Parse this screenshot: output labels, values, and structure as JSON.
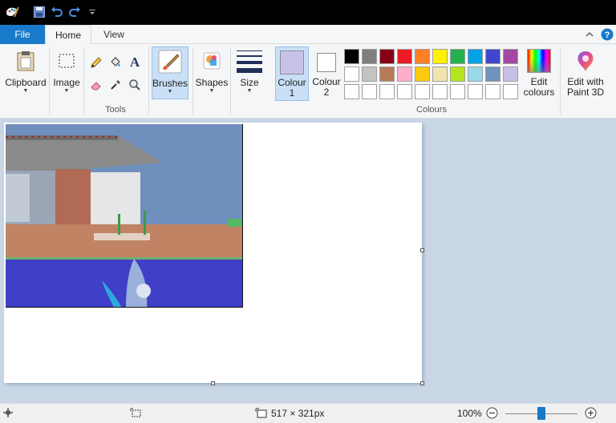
{
  "title_bar": {
    "quick_access": [
      "paint-app-icon",
      "save-icon",
      "undo-icon",
      "redo-icon",
      "customize-qa-icon"
    ]
  },
  "tabs": {
    "file": "File",
    "home": "Home",
    "view": "View"
  },
  "ribbon": {
    "clipboard_label": "Clipboard",
    "image_label": "Image",
    "tools_group": "Tools",
    "brushes_label": "Brushes",
    "shapes_label": "Shapes",
    "size_label": "Size",
    "colour1_line1": "Colour",
    "colour1_line2": "1",
    "colour2_line1": "Colour",
    "colour2_line2": "2",
    "colours_group": "Colours",
    "edit_colours_line1": "Edit",
    "edit_colours_line2": "colours",
    "paint3d_line1": "Edit with",
    "paint3d_line2": "Paint 3D",
    "colour1_value": "#c7c3e8",
    "colour2_value": "#ffffff",
    "palette_row1": [
      "#000000",
      "#7f7f7f",
      "#880015",
      "#ed1c24",
      "#ff7f27",
      "#fff200",
      "#22b14c",
      "#00a2e8",
      "#3f48cc",
      "#a349a4"
    ],
    "palette_row2": [
      "#ffffff",
      "#c3c3c3",
      "#b97a57",
      "#ffaec9",
      "#ffc90e",
      "#efe4b0",
      "#b5e61d",
      "#99d9ea",
      "#7092be",
      "#c8bfe7"
    ],
    "palette_row3": [
      "#ffffff",
      "#ffffff",
      "#ffffff",
      "#ffffff",
      "#ffffff",
      "#ffffff",
      "#ffffff",
      "#ffffff",
      "#ffffff",
      "#ffffff"
    ]
  },
  "status": {
    "image_size": "517 × 321px",
    "zoom": "100%",
    "zoom_level_fraction": 0.5
  }
}
